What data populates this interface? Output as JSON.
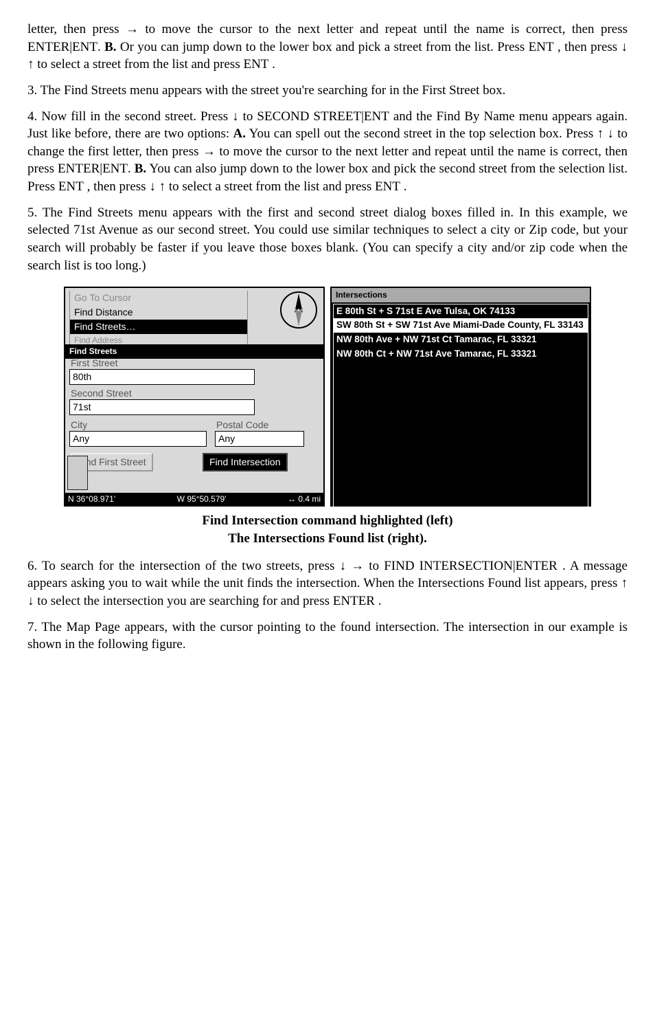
{
  "paragraphs": {
    "p1a": "letter, then press → to move the cursor to the next letter and repeat until the name is correct, then press ",
    "p1b": " Or you can jump down to the lower box and pick a street from the list. Press ",
    "p1c": ", then press ↓ ↑ to select a street from the list and press ",
    "p1d": ".",
    "p2": "3. The Find Streets menu appears with the street you're searching for in the First Street box.",
    "p3a": "4. Now fill in the second street. Press ↓ to ",
    "p3b": " and the Find By Name menu appears again. Just like before, there are two options: ",
    "p3c": " You can spell out the second street in the top selection box. Press ↑ ↓ to change the first letter, then press → to move the cursor to the next letter and repeat until the name is correct, then press ",
    "p3d": " You can also jump down to the lower box and pick the second street from the selection list. Press ",
    "p3e": ", then press ↓ ↑ to select a street from the list and press ",
    "p3f": ".",
    "p4": "5. The Find Streets menu appears with the first and second street dialog boxes filled in. In this example, we selected 71st Avenue as our second street. You could use similar techniques to select a city or Zip code, but your search will probably be faster if you leave those boxes blank. (You can specify a city and/or zip code when the search list is too long.)",
    "p5a": "6. To search for the intersection of the two streets, press ↓ → to ",
    "p5b": ". A message appears asking you to wait while the unit finds the intersection. When the Intersections Found list appears, press ↑ ↓ to select the intersection you are searching for and press ",
    "p5c": ".",
    "p6": "7. The Map Page appears, with the cursor pointing to the found intersection. The intersection in our example is shown in the following figure."
  },
  "smallcaps": {
    "enter_ent": "ENTER|ENT",
    "ent": "ENT",
    "enter": "ENTER",
    "bold_B": "B.",
    "bold_A": "A.",
    "second_street_ent": "SECOND STREET|ENT",
    "find_intersection_enter": "FIND INTERSECTION|ENTER"
  },
  "left_panel": {
    "menu": {
      "go_to_cursor": "Go To Cursor",
      "find_distance": "Find Distance",
      "find_streets": "Find Streets…",
      "find_address": "Find Address"
    },
    "titlebar": "Find Streets",
    "first_street_label": "First Street",
    "first_street_value": "80th",
    "second_street_label": "Second Street",
    "second_street_value": "71st",
    "city_label": "City",
    "city_value": "Any",
    "postal_label": "Postal Code",
    "postal_value": "Any",
    "btn_find_first": "Find First Street",
    "btn_find_intersection": "Find Intersection",
    "status_lat": "N    36°08.971'",
    "status_lon": "W    95°50.579'",
    "status_dist": "↔    0.4 mi"
  },
  "right_panel": {
    "title": "Intersections",
    "items": [
      "E 80th St + S 71st E Ave Tulsa, OK  74133",
      "SW 80th St + SW 71st Ave Miami-Dade County, FL  33143",
      "NW 80th Ave + NW 71st Ct Tamarac, FL  33321",
      "NW 80th Ct + NW 71st Ave Tamarac, FL  33321"
    ]
  },
  "caption": {
    "line1": "Find Intersection command highlighted (left)",
    "line2": "The Intersections Found list (right)."
  }
}
